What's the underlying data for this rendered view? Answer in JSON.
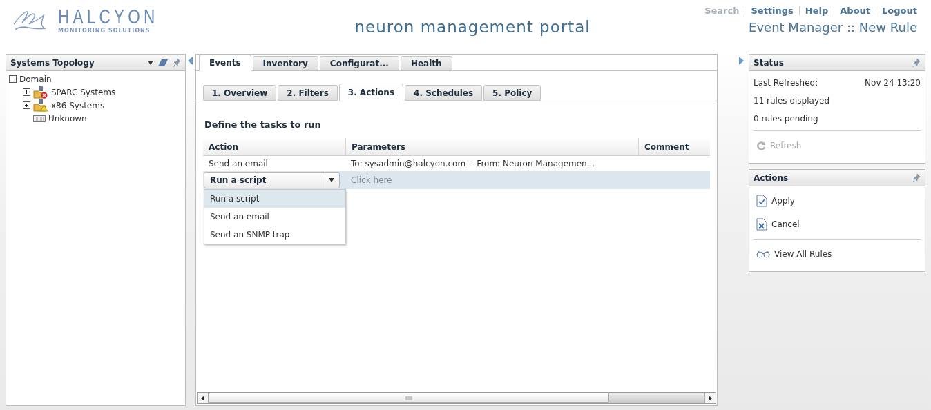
{
  "header": {
    "brand": "HALCYON",
    "tagline": "MONITORING SOLUTIONS",
    "title": "neuron management portal",
    "links": [
      {
        "label": "Search",
        "disabled": true
      },
      {
        "label": "Settings",
        "disabled": false
      },
      {
        "label": "Help",
        "disabled": false
      },
      {
        "label": "About",
        "disabled": false
      },
      {
        "label": "Logout",
        "disabled": false
      }
    ],
    "subtitle": "Event Manager :: New Rule"
  },
  "sidebar": {
    "title": "Systems Topology",
    "tree": [
      {
        "label": "Domain",
        "expanded": true,
        "children": [
          {
            "label": "SPARC Systems",
            "kind": "error",
            "expanded": false
          },
          {
            "label": "x86 Systems",
            "kind": "warning",
            "expanded": false
          },
          {
            "label": "Unknown",
            "kind": "device"
          }
        ]
      }
    ]
  },
  "tabs": [
    {
      "label": "Events",
      "selected": true
    },
    {
      "label": "Inventory",
      "selected": false
    },
    {
      "label": "Configurat...",
      "selected": false
    },
    {
      "label": "Health",
      "selected": false
    }
  ],
  "subtabs": [
    {
      "label": "1. Overview",
      "selected": false
    },
    {
      "label": "2. Filters",
      "selected": false
    },
    {
      "label": "3. Actions",
      "selected": true
    },
    {
      "label": "4. Schedules",
      "selected": false
    },
    {
      "label": "5. Policy",
      "selected": false
    }
  ],
  "heading": "Define the tasks to run",
  "table": {
    "columns": [
      "Action",
      "Parameters",
      "Comment"
    ],
    "rows": [
      {
        "action": "Send an email",
        "parameters": "To: sysadmin@halcyon.com -- From: Neuron Managemen...",
        "selected": false
      },
      {
        "action": "Run a script",
        "parameters_placeholder": "Click here",
        "selected": true,
        "editing": true
      }
    ]
  },
  "dropdown": {
    "options": [
      {
        "label": "Run a script",
        "selected": true
      },
      {
        "label": "Send an email",
        "selected": false
      },
      {
        "label": "Send an SNMP trap",
        "selected": false
      }
    ]
  },
  "status": {
    "title": "Status",
    "last_refreshed_label": "Last Refreshed:",
    "last_refreshed": "Nov 24 13:20",
    "lines": [
      "11 rules displayed",
      "0 rules pending"
    ],
    "refresh": {
      "label": "Refresh",
      "disabled": true
    }
  },
  "actions": {
    "title": "Actions",
    "items": [
      {
        "label": "Apply",
        "kind": "apply"
      },
      {
        "label": "Cancel",
        "kind": "cancel"
      },
      {
        "label": "View All Rules",
        "kind": "view"
      }
    ]
  }
}
